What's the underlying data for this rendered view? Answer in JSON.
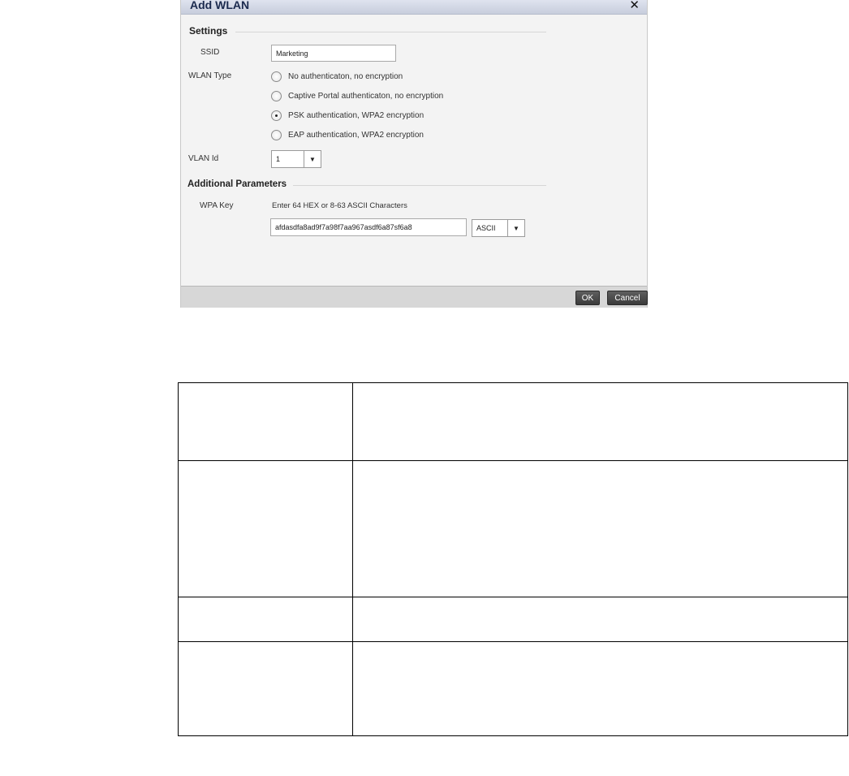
{
  "dialog": {
    "title": "Add WLAN",
    "close_icon": "close-icon",
    "settings": {
      "heading": "Settings",
      "ssid_label": "SSID",
      "ssid_value": "Marketing",
      "wlan_type_label": "WLAN Type",
      "wlan_type_options": [
        {
          "label": "No authenticaton, no encryption",
          "selected": false
        },
        {
          "label": "Captive Portal authenticaton, no encryption",
          "selected": false
        },
        {
          "label": "PSK authentication, WPA2 encryption",
          "selected": true
        },
        {
          "label": "EAP authentication, WPA2 encryption",
          "selected": false
        }
      ],
      "vlan_label": "VLAN Id",
      "vlan_value": "1"
    },
    "additional": {
      "heading": "Additional Parameters",
      "wpa_key_label": "WPA Key",
      "wpa_key_hint": "Enter 64 HEX or 8-63 ASCII Characters",
      "wpa_key_value": "afdasdfa8ad9f7a98f7aa967asdf6a87sf6a8",
      "key_format_value": "ASCII"
    },
    "buttons": {
      "ok": "OK",
      "cancel": "Cancel"
    }
  },
  "table": {
    "rows": [
      {
        "col1": "",
        "col2": ""
      },
      {
        "col1": "",
        "col2": ""
      },
      {
        "col1": "",
        "col2": ""
      },
      {
        "col1": "",
        "col2": ""
      }
    ]
  }
}
